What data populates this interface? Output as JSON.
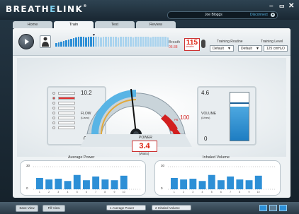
{
  "app": {
    "logo_main": "BREATH",
    "logo_accent": "E",
    "logo_end": "LINK",
    "trademark": "®"
  },
  "window": {
    "minimize": "–",
    "maximize": "▭",
    "close": "✕"
  },
  "user": {
    "name": "Joe Bloggs",
    "status": "Disconnect",
    "icon": "user-icon"
  },
  "tabs": [
    {
      "label": "Home"
    },
    {
      "label": "Train"
    },
    {
      "label": "Test"
    },
    {
      "label": "Review"
    }
  ],
  "toolbar": {
    "breath_label": "Breath",
    "breath_sub": "05:38",
    "breath_value": "115",
    "breath_unit": "breaths",
    "training_routine_label": "Training Routine",
    "training_routine_value": "Default",
    "training_level_label": "Training Level",
    "training_level_value": "Default",
    "training_level_extra": "125 cmH₂O"
  },
  "flow": {
    "max": "10.2",
    "min": "0",
    "label": "FLOW",
    "unit": "(L/sec)"
  },
  "volume": {
    "max": "4.6",
    "min": "0",
    "label": "VOLUME",
    "unit": "(Litres)"
  },
  "gauge": {
    "label": "POWER",
    "value": "3.4",
    "unit": "(Watts)",
    "pb_label": "PB",
    "pb_value": "100"
  },
  "charts": {
    "avg_power_title": "Average Power",
    "inhaled_volume_title": "Inhaled Volume",
    "avg_power_y_max": "30",
    "avg_power_y_min": "0",
    "inhaled_volume_y_max": "30",
    "inhaled_volume_y_min": "0"
  },
  "bottom": {
    "btn1": "Save View",
    "btn2": "Fill View",
    "select1": "1 Average Power",
    "select2": "2 Inhaled Volume"
  },
  "chart_data": [
    {
      "type": "bar",
      "title": "Average Power",
      "categories": [
        "1",
        "2",
        "3",
        "4",
        "5",
        "6",
        "7",
        "8",
        "9",
        "10"
      ],
      "values": [
        15,
        13,
        14,
        11,
        19,
        12,
        17,
        13,
        12,
        18
      ],
      "ylim": [
        0,
        30
      ]
    },
    {
      "type": "bar",
      "title": "Inhaled Volume",
      "categories": [
        "1",
        "2",
        "3",
        "4",
        "5",
        "6",
        "7",
        "8",
        "9",
        "10"
      ],
      "values": [
        15,
        13,
        14,
        11,
        19,
        12,
        17,
        13,
        12,
        18
      ],
      "ylim": [
        0,
        30
      ]
    }
  ],
  "colors": {
    "accent": "#2d8fd6",
    "alert": "#d21f1f",
    "gauge_arc": "#58b4e5",
    "gold": "#e3a93a"
  }
}
